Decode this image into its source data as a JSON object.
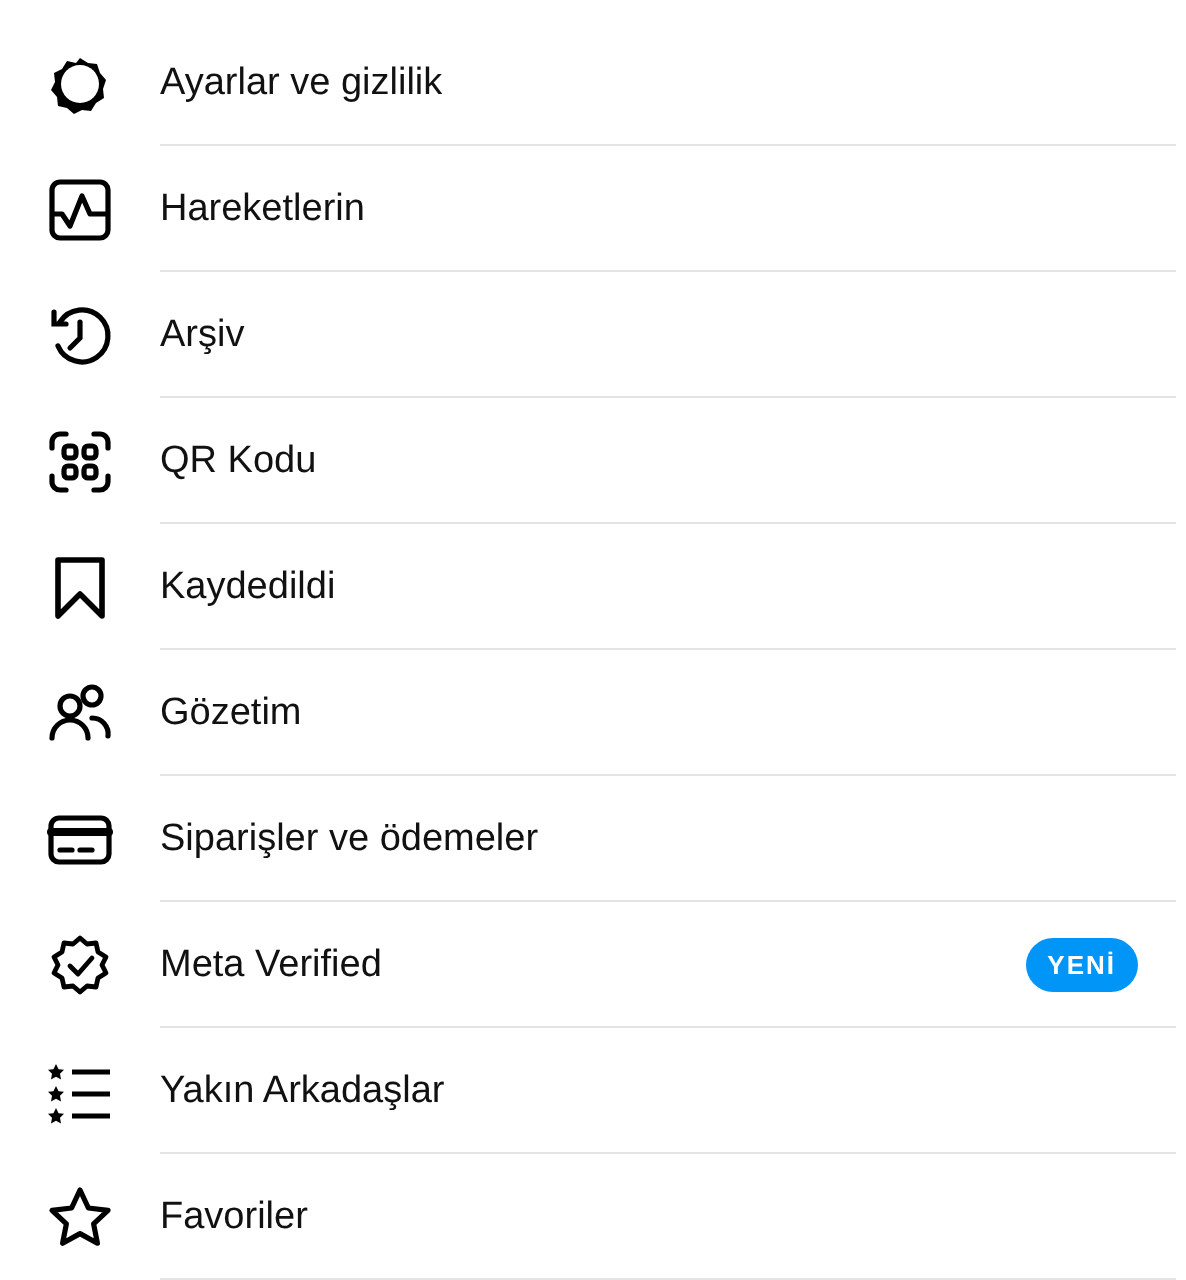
{
  "menu": [
    {
      "kind": "settings",
      "label": "Ayarlar ve gizlilik"
    },
    {
      "kind": "activity",
      "label": "Hareketlerin"
    },
    {
      "kind": "archive",
      "label": "Arşiv"
    },
    {
      "kind": "qr",
      "label": "QR Kodu"
    },
    {
      "kind": "bookmark",
      "label": "Kaydedildi"
    },
    {
      "kind": "people",
      "label": "Gözetim"
    },
    {
      "kind": "card",
      "label": "Siparişler ve ödemeler"
    },
    {
      "kind": "verified",
      "label": "Meta Verified",
      "badge": "YENİ"
    },
    {
      "kind": "starlist",
      "label": "Yakın Arkadaşlar"
    },
    {
      "kind": "star",
      "label": "Favoriler"
    }
  ]
}
